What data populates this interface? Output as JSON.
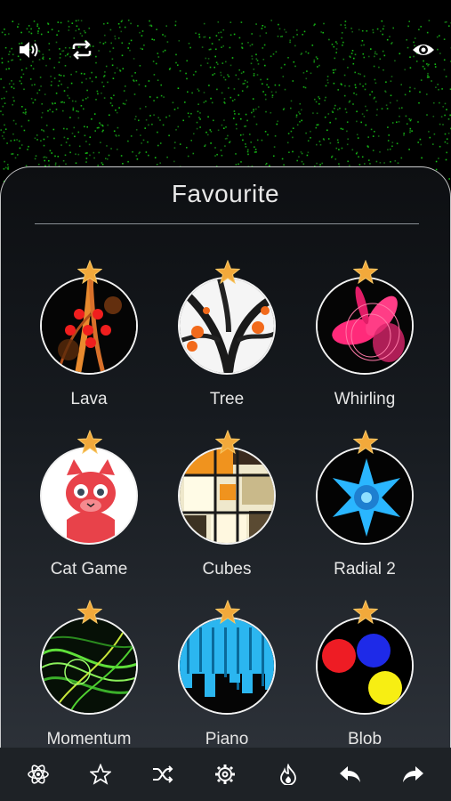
{
  "panel": {
    "title": "Favourite"
  },
  "items": [
    {
      "name": "Lava"
    },
    {
      "name": "Tree"
    },
    {
      "name": "Whirling"
    },
    {
      "name": "Cat Game"
    },
    {
      "name": "Cubes"
    },
    {
      "name": "Radial 2"
    },
    {
      "name": "Momentum"
    },
    {
      "name": "Piano"
    },
    {
      "name": "Blob"
    }
  ],
  "top_icons": [
    "volume-icon",
    "repeat-icon",
    "eye-icon"
  ],
  "toolbar_icons": [
    "atom-icon",
    "star-icon",
    "shuffle-icon",
    "gear-icon",
    "flame-icon",
    "undo-icon",
    "redo-icon"
  ],
  "colors": {
    "accent_star": "#f2a93b",
    "starfield": "#2f8f2f",
    "toolbar_bg": "#1e2226",
    "label_text": "#e6e6e6"
  }
}
